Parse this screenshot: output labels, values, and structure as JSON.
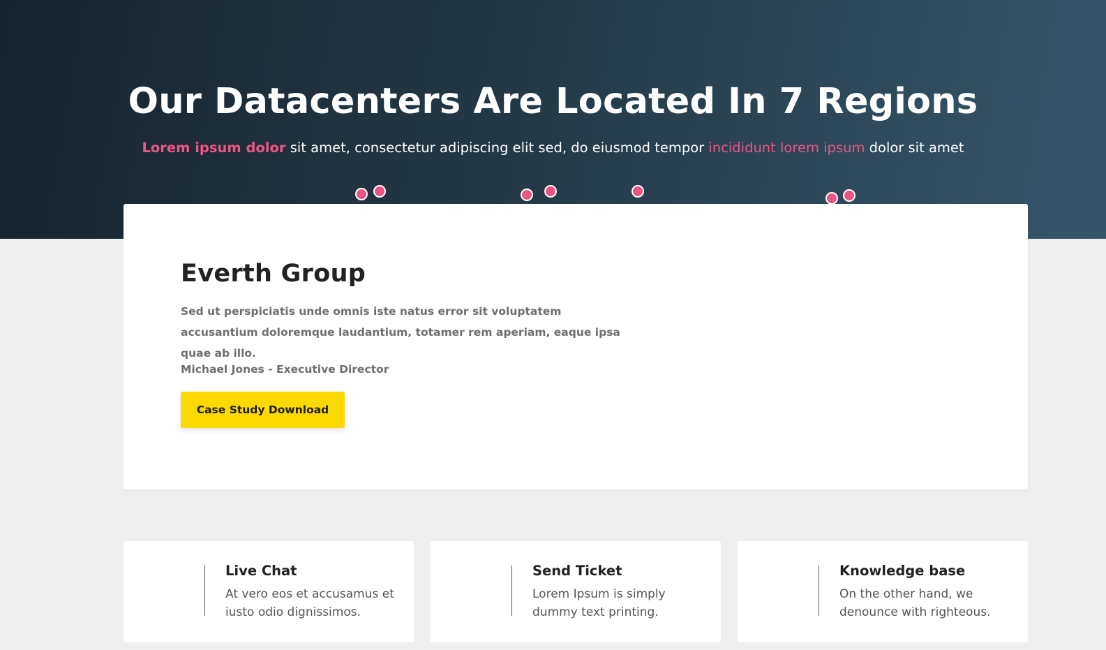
{
  "hero": {
    "title": "Our Datacenters Are Located In 7 Regions",
    "subtitle": {
      "highlight_bold": "Lorem ipsum dolor",
      "text_1": " sit amet, consectetur adipiscing elit sed, do eiusmod tempor ",
      "highlight": "incididunt lorem ipsum",
      "text_2": " dolor sit amet"
    }
  },
  "colors": {
    "accent_pink": "#ea5585",
    "button_yellow": "#fcd900",
    "hero_dark": "#17232d",
    "hero_light": "#35566a"
  },
  "case_study": {
    "title": "Everth Group",
    "description": "Sed ut perspiciatis unde omnis iste natus error sit voluptatem accusantium doloremque laudantium, totamer rem aperiam, eaque ipsa quae ab illo.",
    "author": "Michael Jones - Executive Director",
    "button_label": "Case Study Download"
  },
  "support": [
    {
      "title": "Live Chat",
      "text": "At vero eos et accusamus et iusto odio dignissimos."
    },
    {
      "title": "Send Ticket",
      "text": "Lorem Ipsum is simply dummy text printing."
    },
    {
      "title": "Knowledge base",
      "text": "On the other hand, we denounce with righteous."
    }
  ]
}
